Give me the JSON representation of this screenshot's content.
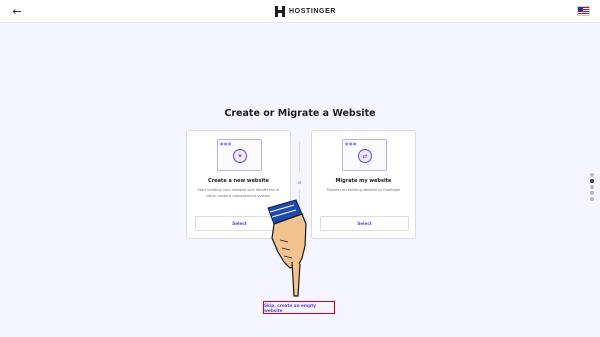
{
  "header": {
    "back_icon": "arrow-left-icon",
    "logo_text": "HOSTINGER",
    "language_flag": "us-flag-icon"
  },
  "page": {
    "title": "Create or Migrate a Website",
    "separator_text": "or"
  },
  "cards": [
    {
      "title": "Create a new website",
      "description": "Start building your website with WordPress or other content management system",
      "button": "Select",
      "icon": "magic-wand-icon"
    },
    {
      "title": "Migrate my website",
      "description": "Transfer an existing website to Hostinger",
      "button": "Select",
      "icon": "transfer-arrows-icon"
    }
  ],
  "skip_link": "Skip, create an empty website",
  "stepper": {
    "total": 5,
    "active_index": 1
  },
  "colors": {
    "accent": "#673de6",
    "background": "#f4f5ff",
    "highlight_box": "#d0021b"
  }
}
